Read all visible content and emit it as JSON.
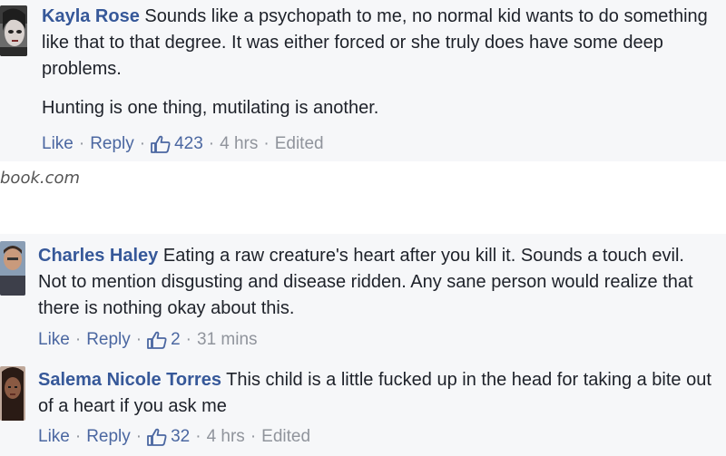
{
  "source_text": "book.com",
  "comments": [
    {
      "author": "Kayla Rose",
      "text": "Sounds like a psychopath to me, no normal kid wants to do something like that to that degree. It was either forced or she truly does have some deep problems.",
      "text2": "Hunting is one thing, mutilating is another.",
      "like_label": "Like",
      "reply_label": "Reply",
      "like_count": "423",
      "time": "4 hrs",
      "edited": "Edited"
    },
    {
      "author": "Charles Haley",
      "text": "Eating a raw creature's heart after you kill it. Sounds a touch evil. Not to mention disgusting and disease ridden. Any sane person would realize that there is nothing okay about this.",
      "like_label": "Like",
      "reply_label": "Reply",
      "like_count": "2",
      "time": "31 mins"
    },
    {
      "author": "Salema Nicole Torres",
      "text": "This child is a little fucked up in the head for taking a bite out of a heart if you ask me",
      "like_label": "Like",
      "reply_label": "Reply",
      "like_count": "32",
      "time": "4 hrs",
      "edited": "Edited"
    }
  ],
  "colors": {
    "author": "#365899",
    "link": "#4b67a1",
    "meta": "#90949c",
    "panel_bg": "#f6f7f9"
  }
}
